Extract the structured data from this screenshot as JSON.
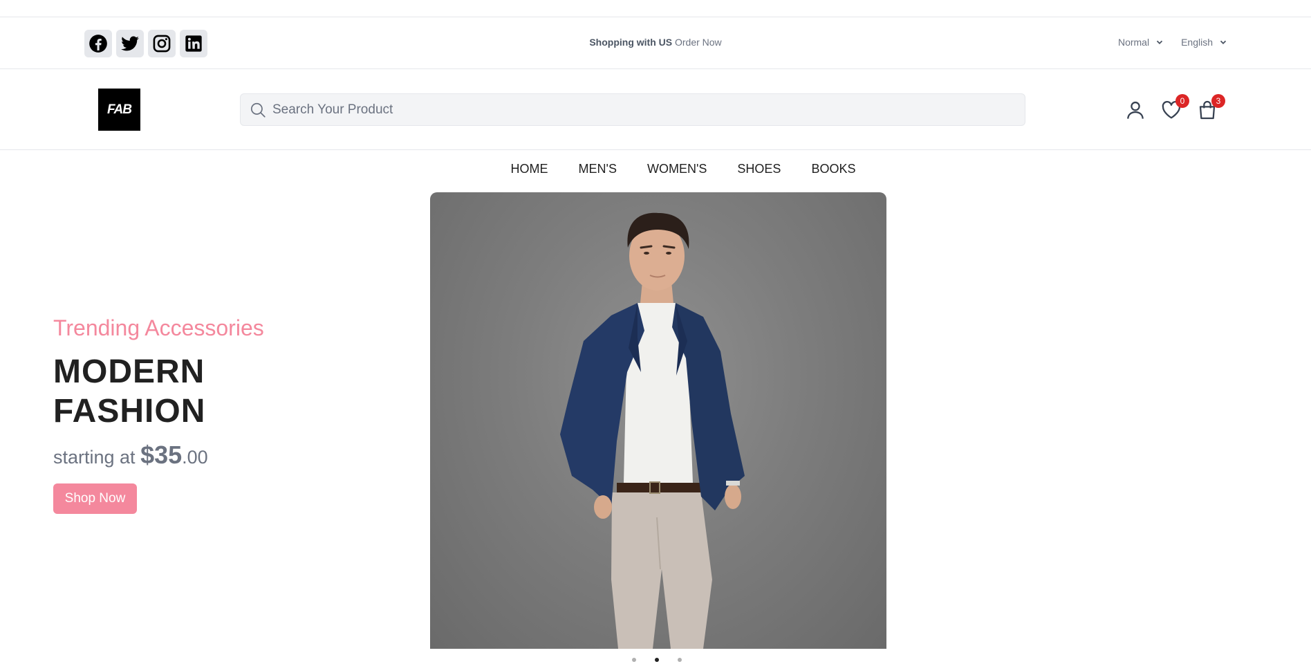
{
  "topbar": {
    "socials": [
      {
        "name": "facebook-icon"
      },
      {
        "name": "twitter-icon"
      },
      {
        "name": "instagram-icon"
      },
      {
        "name": "linkedin-icon"
      }
    ],
    "promo_bold": "Shopping with US",
    "promo_text": " Order Now",
    "mode_select": "Normal",
    "language_select": "English"
  },
  "header": {
    "logo_text": "FAB",
    "search_placeholder": "Search Your Product",
    "search_value": "",
    "wishlist_count": "0",
    "cart_count": "3"
  },
  "nav": {
    "items": [
      "HOME",
      "MEN'S",
      "WOMEN'S",
      "SHOES",
      "BOOKS"
    ]
  },
  "hero": {
    "subtitle": "Trending Accessories",
    "title_line1": "MODERN",
    "title_line2": "FASHION",
    "price_prefix": "starting at ",
    "price_main": "$35",
    "price_cents": ".00",
    "button_label": "Shop Now",
    "slide_count": 3,
    "active_slide": 2
  },
  "colors": {
    "accent": "#f4889d",
    "badge": "#dc2626",
    "text": "#212121",
    "muted": "#6b7280"
  }
}
